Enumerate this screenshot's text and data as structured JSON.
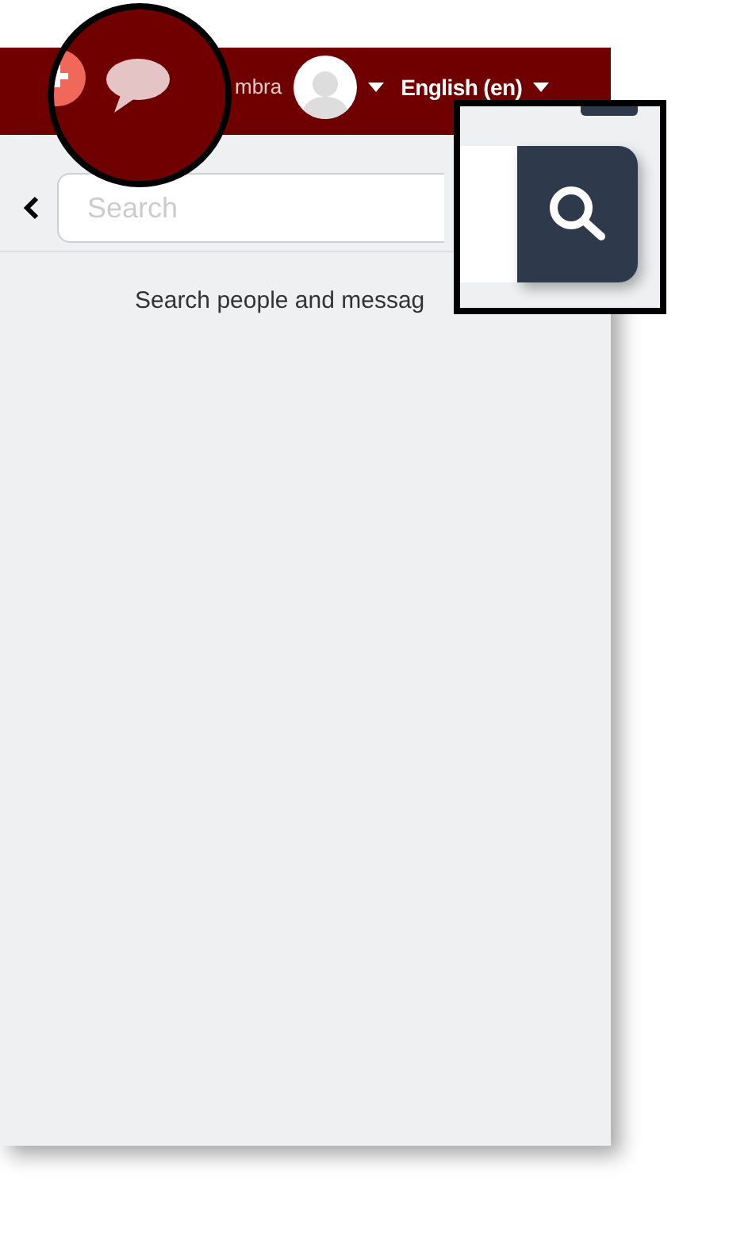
{
  "header": {
    "user_name": "mbra",
    "language": "English (en)"
  },
  "search": {
    "placeholder": "Search"
  },
  "empty_message": "Search people and messag"
}
